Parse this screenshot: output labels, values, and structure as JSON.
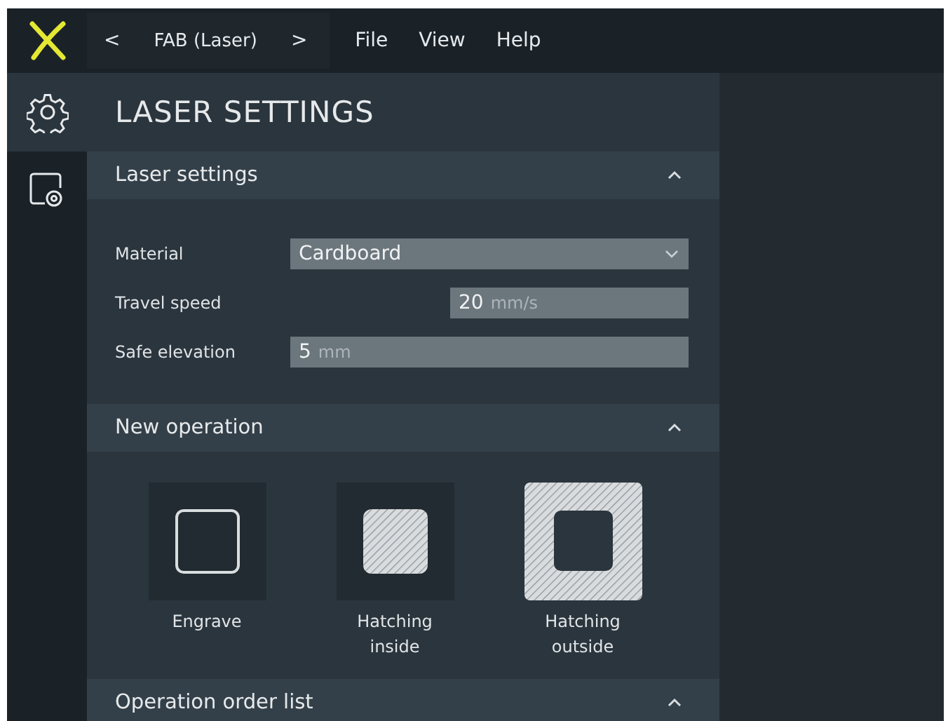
{
  "top_bar": {
    "breadcrumb": {
      "prev": "<",
      "label": "FAB (Laser)",
      "next": ">"
    },
    "menu": [
      "File",
      "View",
      "Help"
    ]
  },
  "sidebar": {
    "items": [
      {
        "kind": "settings",
        "selected": true
      },
      {
        "kind": "device-settings",
        "selected": false
      }
    ]
  },
  "panel": {
    "title": "LASER SETTINGS",
    "sections": [
      {
        "title": "Laser settings",
        "expanded": true,
        "kind": "form",
        "fields": [
          {
            "label": "Material",
            "kind": "dropdown",
            "value": "Cardboard"
          },
          {
            "label": "Travel speed",
            "kind": "number-short",
            "value": "20",
            "unit": "mm/s"
          },
          {
            "label": "Safe elevation",
            "kind": "number",
            "value": "5",
            "unit": "mm"
          }
        ]
      },
      {
        "title": "New operation",
        "expanded": true,
        "kind": "operations",
        "operations": [
          {
            "label": "Engrave",
            "kind": "engrave",
            "selected": false
          },
          {
            "label": "Hatching inside",
            "kind": "hatch-inside",
            "selected": false
          },
          {
            "label": "Hatching outside",
            "kind": "hatch-outside",
            "selected": true
          }
        ]
      },
      {
        "title": "Operation order list",
        "expanded": true,
        "kind": "list"
      }
    ]
  }
}
